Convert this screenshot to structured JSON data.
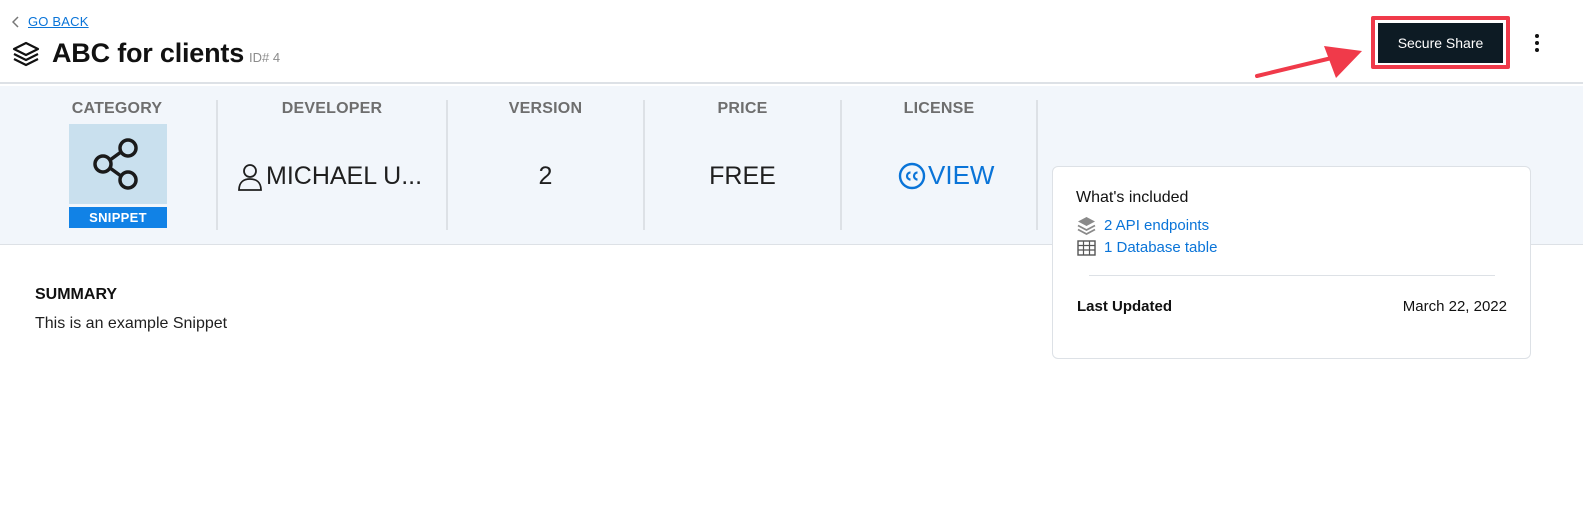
{
  "header": {
    "back_label": "GO BACK",
    "title": "ABC for clients",
    "id_label": "ID# 4",
    "share_button": "Secure Share"
  },
  "stats": {
    "category": {
      "label": "CATEGORY",
      "badge": "SNIPPET",
      "icon": "share-nodes-icon"
    },
    "developer": {
      "label": "DEVELOPER",
      "value": "MICHAEL U..."
    },
    "version": {
      "label": "VERSION",
      "value": "2"
    },
    "price": {
      "label": "PRICE",
      "value": "FREE"
    },
    "license": {
      "label": "LICENSE",
      "value": "VIEW"
    }
  },
  "summary": {
    "heading": "SUMMARY",
    "text": "This is an example Snippet"
  },
  "included": {
    "title": "What's included",
    "items": [
      {
        "label": "2 API endpoints",
        "icon": "api-icon"
      },
      {
        "label": "1 Database table",
        "icon": "table-icon"
      }
    ],
    "last_updated_label": "Last Updated",
    "last_updated_value": "March 22, 2022"
  },
  "colors": {
    "accent": "#0a74d8",
    "highlight": "#f03a4a",
    "button_bg": "#0d1b24",
    "stats_bg": "#f2f6fb",
    "badge_bg": "#1182e6"
  }
}
